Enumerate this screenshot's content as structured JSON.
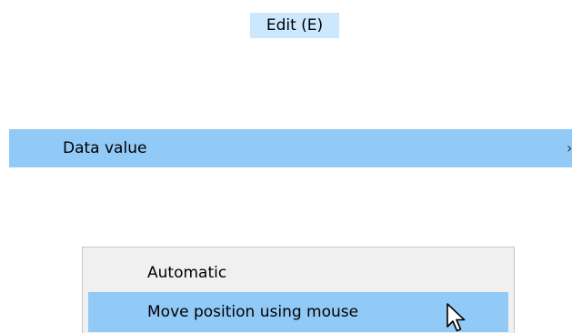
{
  "menubar": {
    "edit_label": "Edit (E)"
  },
  "submenu": {
    "data_value_label": "Data value",
    "data_value_chevron": "›"
  },
  "popup": {
    "items": [
      {
        "label": "Automatic"
      },
      {
        "label": "Move position using mouse"
      }
    ]
  },
  "colors": {
    "menubar_highlight": "#cce8ff",
    "row_highlight": "#91c9f7",
    "popup_background": "#f0f0f0",
    "popup_border": "#c8c8c8"
  },
  "icons": {
    "cursor": "arrow-pointer-icon",
    "submenu_arrow": "chevron-right-icon"
  }
}
